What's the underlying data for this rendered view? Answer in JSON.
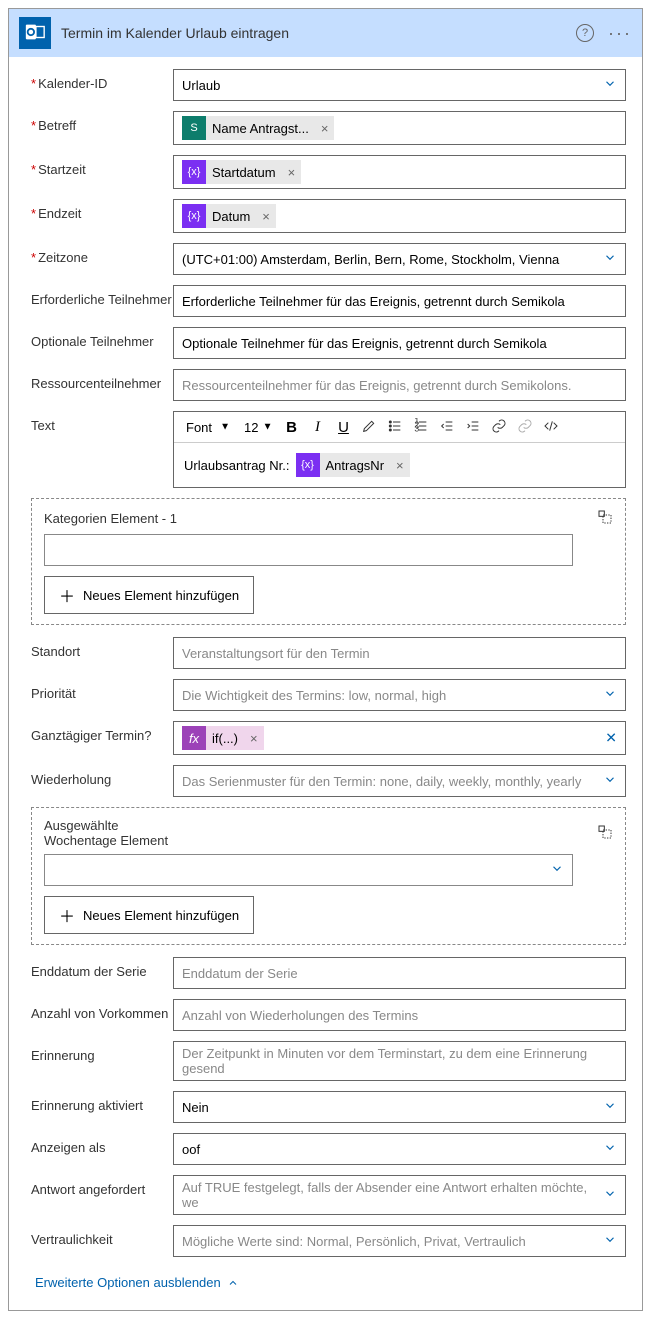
{
  "header": {
    "title": "Termin im Kalender Urlaub eintragen"
  },
  "fields": {
    "kalender_id": {
      "label": "Kalender-ID",
      "value": "Urlaub"
    },
    "betreff": {
      "label": "Betreff",
      "token": "Name Antragst..."
    },
    "startzeit": {
      "label": "Startzeit",
      "token": "Startdatum"
    },
    "endzeit": {
      "label": "Endzeit",
      "token": "Datum"
    },
    "zeitzone": {
      "label": "Zeitzone",
      "value": "(UTC+01:00) Amsterdam, Berlin, Bern, Rome, Stockholm, Vienna"
    },
    "erf_teilnehmer": {
      "label": "Erforderliche Teilnehmer",
      "value": "Erforderliche Teilnehmer für das Ereignis, getrennt durch Semikola"
    },
    "opt_teilnehmer": {
      "label": "Optionale Teilnehmer",
      "value": "Optionale Teilnehmer für das Ereignis, getrennt durch Semikola"
    },
    "res_teilnehmer": {
      "label": "Ressourcenteilnehmer",
      "placeholder": "Ressourcenteilnehmer für das Ereignis, getrennt durch Semikolons."
    },
    "text": {
      "label": "Text",
      "prefix": "Urlaubsantrag Nr.:",
      "token": "AntragsNr"
    },
    "standort": {
      "label": "Standort",
      "placeholder": "Veranstaltungsort für den Termin"
    },
    "prioritaet": {
      "label": "Priorität",
      "placeholder": "Die Wichtigkeit des Termins: low, normal, high"
    },
    "ganztag": {
      "label": "Ganztägiger Termin?",
      "token": "if(...)"
    },
    "wiederholung": {
      "label": "Wiederholung",
      "placeholder": "Das Serienmuster für den Termin: none, daily, weekly, monthly, yearly"
    },
    "enddatum": {
      "label": "Enddatum der Serie",
      "placeholder": "Enddatum der Serie"
    },
    "anzahl": {
      "label": "Anzahl von Vorkommen",
      "placeholder": "Anzahl von Wiederholungen des Termins"
    },
    "erinnerung": {
      "label": "Erinnerung",
      "placeholder": "Der Zeitpunkt in Minuten vor dem Terminstart, zu dem eine Erinnerung gesend"
    },
    "erinnerung_aktiv": {
      "label": "Erinnerung aktiviert",
      "value": "Nein"
    },
    "anzeigen_als": {
      "label": "Anzeigen als",
      "value": "oof"
    },
    "antwort": {
      "label": "Antwort angefordert",
      "placeholder": "Auf TRUE festgelegt, falls der Absender eine Antwort erhalten möchte, we"
    },
    "vertraulichkeit": {
      "label": "Vertraulichkeit",
      "placeholder": "Mögliche Werte sind: Normal, Persönlich, Privat, Vertraulich"
    }
  },
  "toolbar": {
    "font": "Font",
    "size": "12"
  },
  "kategorien": {
    "title": "Kategorien Element - 1",
    "add": "Neues Element hinzufügen"
  },
  "wochentage": {
    "title": "Ausgewählte Wochentage Element",
    "add": "Neues Element hinzufügen"
  },
  "footer": {
    "link": "Erweiterte Optionen ausblenden"
  }
}
